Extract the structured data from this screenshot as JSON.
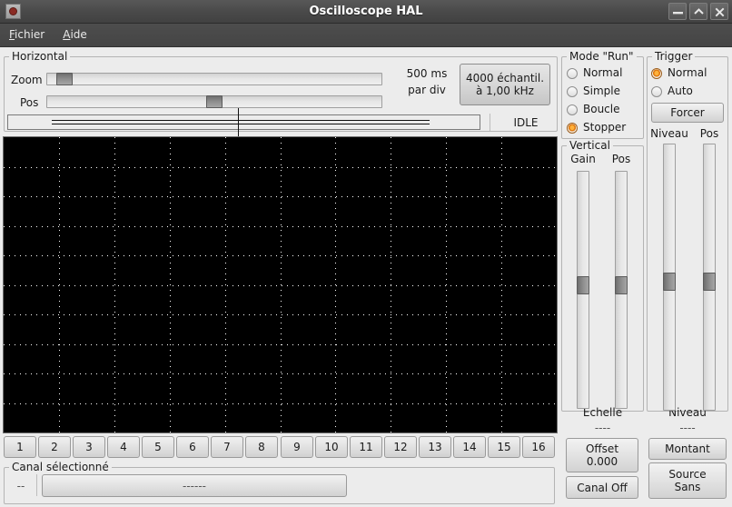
{
  "window": {
    "title": "Oscilloscope HAL",
    "buttons": {
      "minimize": "minimize-icon",
      "maximize": "maximize-icon",
      "close": "close-icon"
    }
  },
  "menu": {
    "items": [
      {
        "label": "Fichier",
        "mnemonic": "F"
      },
      {
        "label": "Aide",
        "mnemonic": "A"
      }
    ]
  },
  "horizontal": {
    "group_label": "Horizontal",
    "zoom_label": "Zoom",
    "pos_label": "Pos",
    "zoom_value": 3,
    "pos_value": 50,
    "timebase": "500 ms",
    "timebase_unit": "par div",
    "samples_line1": "4000 échantil.",
    "samples_line2": "à 1,00 kHz",
    "status": "IDLE"
  },
  "run_mode": {
    "group_label": "Mode \"Run\"",
    "options": [
      {
        "label": "Normal",
        "selected": false
      },
      {
        "label": "Simple",
        "selected": false
      },
      {
        "label": "Boucle",
        "selected": false
      },
      {
        "label": "Stopper",
        "selected": true
      }
    ]
  },
  "trigger": {
    "group_label": "Trigger",
    "options": [
      {
        "label": "Normal",
        "selected": true
      },
      {
        "label": "Auto",
        "selected": false
      }
    ],
    "force_label": "Forcer",
    "niveau_label": "Niveau",
    "pos_label": "Pos",
    "niveau_value": 52,
    "pos_value": 52,
    "readout_label": "Niveau",
    "readout_value": "----",
    "edge_label": "Montant",
    "source_line1": "Source",
    "source_line2": "Sans"
  },
  "vertical": {
    "group_label": "Vertical",
    "gain_label": "Gain",
    "pos_label": "Pos",
    "gain_value": 48,
    "pos_value": 48,
    "readout_label": "Échelle",
    "readout_value": "----",
    "offset_line1": "Offset",
    "offset_line2": "0.000",
    "channel_toggle": "Canal Off"
  },
  "channels": {
    "buttons": [
      "1",
      "2",
      "3",
      "4",
      "5",
      "6",
      "7",
      "8",
      "9",
      "10",
      "11",
      "12",
      "13",
      "14",
      "15",
      "16"
    ]
  },
  "selected_channel": {
    "group_label": "Canal sélectionné",
    "index": "--",
    "name": "------"
  },
  "colors": {
    "window_bg": "#ececec",
    "titlebar": "#4a4a4a",
    "scope_bg": "#000000",
    "grid": "#ffffff",
    "accent": "#e07b12"
  }
}
